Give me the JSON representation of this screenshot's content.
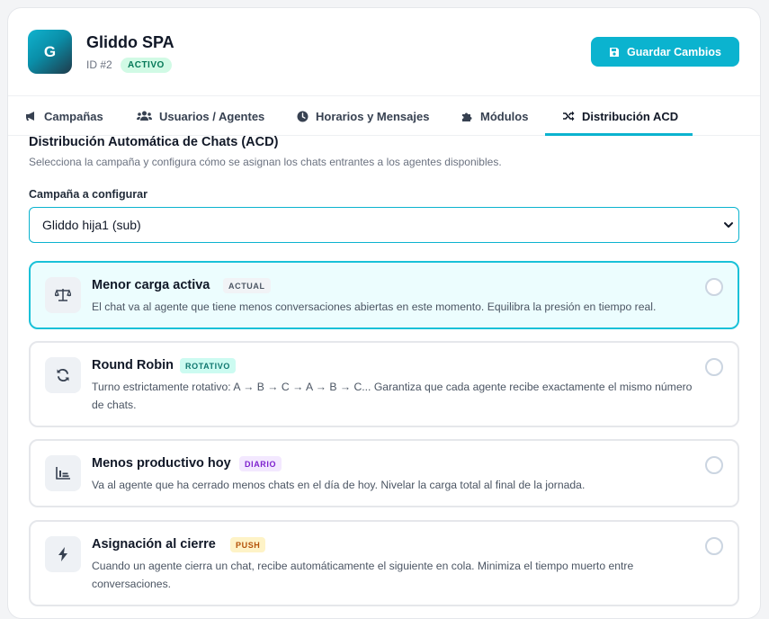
{
  "org": {
    "logo_letter": "G",
    "name": "Gliddo SPA",
    "id_label": "ID #2",
    "status": "ACTIVO",
    "save_label": "Guardar Cambios"
  },
  "tabs": [
    {
      "label": "Campañas",
      "icon": "megaphone-icon"
    },
    {
      "label": "Usuarios / Agentes",
      "icon": "users-icon"
    },
    {
      "label": "Horarios y Mensajes",
      "icon": "clock-icon"
    },
    {
      "label": "Módulos",
      "icon": "puzzle-icon"
    },
    {
      "label": "Distribución ACD",
      "icon": "shuffle-icon",
      "active": true
    }
  ],
  "section": {
    "title": "Distribución Automática de Chats (ACD)",
    "description": "Selecciona la campaña y configura cómo se asignan los chats entrantes a los agentes disponibles.",
    "campaign_label": "Campaña a configurar",
    "campaign_value": "Gliddo hija1 (sub)"
  },
  "options": [
    {
      "title": "Menor carga activa",
      "tag": "ACTUAL",
      "tag_bg": "#f1f3f6",
      "tag_color": "#4b5563",
      "icon": "balance-scale-icon",
      "description": "El chat va al agente que tiene menos conversaciones abiertas en este momento. Equilibra la presión en tiempo real.",
      "selected": true
    },
    {
      "title": "Round Robin",
      "tag": "ROTATIVO",
      "tag_bg": "#ccfbf1",
      "tag_color": "#0f766e",
      "icon": "sync-icon",
      "description": "Turno estrictamente rotativo: A → B → C → A → B → C... Garantiza que cada agente recibe exactamente el mismo número de chats.",
      "selected": false
    },
    {
      "title": "Menos productivo hoy",
      "tag": "DIARIO",
      "tag_bg": "#f3e8ff",
      "tag_color": "#7e22ce",
      "icon": "bar-chart-icon",
      "description": "Va al agente que ha cerrado menos chats en el día de hoy. Nivelar la carga total al final de la jornada.",
      "selected": false
    },
    {
      "title": "Asignación al cierre",
      "tag": "PUSH",
      "tag_bg": "#fef3c7",
      "tag_color": "#b45309",
      "icon": "bolt-icon",
      "description": "Cuando un agente cierra un chat, recibe automáticamente el siguiente en cola. Minimiza el tiempo muerto entre conversaciones.",
      "selected": false
    }
  ],
  "colors": {
    "accent": "#0bb3cf",
    "selected_bg": "#ecfdfe",
    "active_badge_bg": "#d1fae5",
    "active_badge_text": "#047857"
  }
}
